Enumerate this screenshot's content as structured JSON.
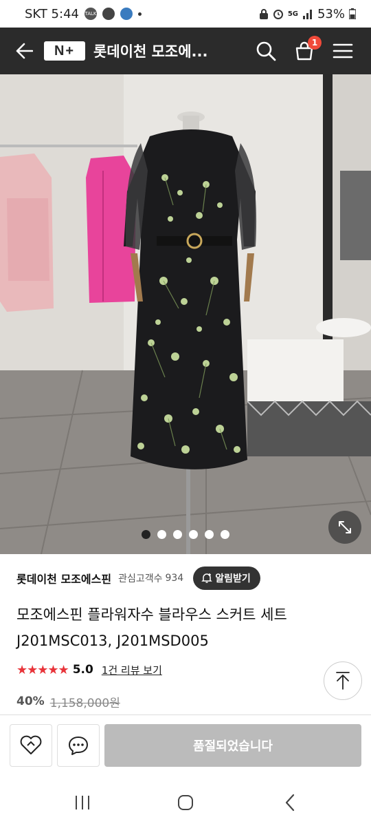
{
  "status_bar": {
    "carrier_time": "SKT 5:44",
    "talk_badge": "TALK",
    "network": "5G",
    "battery": "53%"
  },
  "header": {
    "logo_text": "N+",
    "title": "롯데이천 모조에...",
    "cart_count": "1"
  },
  "gallery": {
    "image_count": 6,
    "active_index": 0
  },
  "seller": {
    "name": "롯데이천 모조에스핀",
    "fav_label": "관심고객수",
    "fav_count": "934",
    "notify_label": "알림받기"
  },
  "product": {
    "name_line1": "모조에스핀 플라워자수 블라우스 스커트 세트",
    "name_line2": "J201MSC013, J201MSD005",
    "stars": "★★★★★",
    "rating": "5.0",
    "review_link": "1건 리뷰 보기",
    "discount": "40%",
    "original_price": "1,158,000원"
  },
  "actions": {
    "soldout_label": "품절되었습니다"
  },
  "colors": {
    "header_bg": "#2b2b2b",
    "badge": "#f04a3a",
    "star": "#e8343a",
    "soldout_bg": "#bbbbbb"
  },
  "icons": [
    "back-arrow-icon",
    "search-icon",
    "cart-icon",
    "menu-icon",
    "expand-icon",
    "bell-plus-icon",
    "heart-icon",
    "chat-icon",
    "arrow-up-icon",
    "recent-apps-icon",
    "home-icon",
    "nav-back-icon"
  ]
}
